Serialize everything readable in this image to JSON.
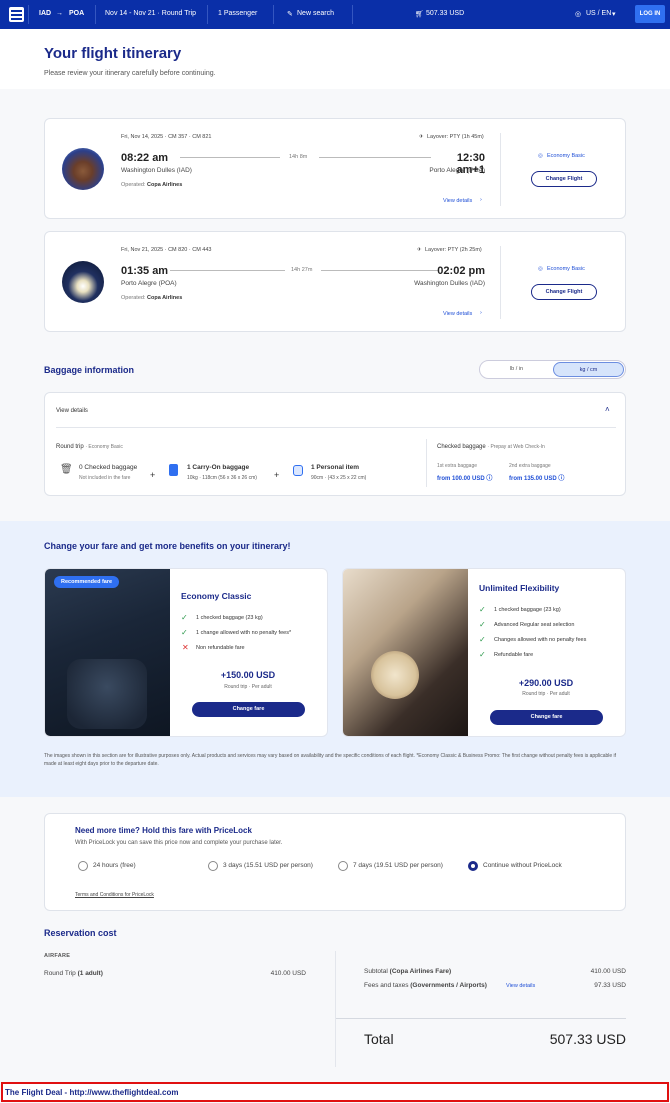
{
  "header": {
    "origin": "IAD",
    "destination": "POA",
    "arrow": "→",
    "dates": "Nov 14 - Nov 21 · Round Trip",
    "passengers": "1 Passenger",
    "new_search": "New search",
    "total": "507.33 USD",
    "locale": "US / EN",
    "login": "LOG IN"
  },
  "page": {
    "title": "Your flight itinerary",
    "subtitle": "Please review your itinerary carefully before continuing."
  },
  "flights": [
    {
      "date": "Fri, Nov 14, 2025 · CM 357 · CM 821",
      "layover": "Layover: PTY (1h 45m)",
      "dep_time": "08:22 am",
      "arr_time": "12:30 am+1",
      "duration": "14h 8m",
      "from": "Washington Dulles (IAD)",
      "to": "Porto Alegre (POA)",
      "operated_label": "Operated:",
      "operated_by": "Copa Airlines",
      "details": "View details",
      "fare": "Economy Basic",
      "change": "Change Flight"
    },
    {
      "date": "Fri, Nov 21, 2025 · CM 820 · CM 443",
      "layover": "Layover: PTY (2h 25m)",
      "dep_time": "01:35 am",
      "arr_time": "02:02 pm",
      "duration": "14h 27m",
      "from": "Porto Alegre (POA)",
      "to": "Washington Dulles (IAD)",
      "operated_label": "Operated:",
      "operated_by": "Copa Airlines",
      "details": "View details",
      "fare": "Economy Basic",
      "change": "Change Flight"
    }
  ],
  "baggage": {
    "title": "Baggage information",
    "unit_imperial": "lb / in",
    "unit_metric": "kg / cm",
    "view_details": "View details",
    "round_trip": "Round trip",
    "fare": "· Economy Basic",
    "checked_title": "0 Checked baggage",
    "checked_sub": "Not included in the fare",
    "carry_title": "1 Carry-On baggage",
    "carry_sub": "10kg · 118cm (56 x 36 x 26 cm)",
    "personal_title": "1 Personal item",
    "personal_sub": "90cm · (43 x 25 x 22 cm)",
    "checked_header": "Checked baggage",
    "prepay": "· Prepay at Web Check-In",
    "first_label": "1st extra baggage",
    "first_price": "from 100.00 USD",
    "second_label": "2nd extra baggage",
    "second_price": "from 135.00 USD",
    "plus": "+"
  },
  "upgrade": {
    "title": "Change your fare and get more benefits on your itinerary!",
    "classic": {
      "badge": "Recommended fare",
      "name": "Economy Classic",
      "b1": "1 checked baggage (23 kg)",
      "b2": "1 change allowed with no penalty fees*",
      "b3": "Non refundable fare",
      "price": "+150.00 USD",
      "per": "Round trip · Per adult",
      "button": "Change fare"
    },
    "flex": {
      "name": "Unlimited Flexibility",
      "b1": "1 checked baggage (23 kg)",
      "b2": "Advanced Regular seat selection",
      "b3": "Changes allowed with no penalty fees",
      "b4": "Refundable fare",
      "price": "+290.00 USD",
      "per": "Round trip · Per adult",
      "button": "Change fare"
    },
    "disclaimer": "The images shown in this section are for illustrative purposes only. Actual products and services may vary based on availability and the specific conditions of each flight. *Economy Classic & Business Promo: The first change without penalty fees is applicable if made at least eight days prior to the departure date."
  },
  "pricelock": {
    "title": "Need more time? Hold this fare with PriceLock",
    "subtitle": "With PriceLock you can save this price now and complete your purchase later.",
    "o1": "24 hours (free)",
    "o2": "3 days (15.51 USD per person)",
    "o3": "7 days (19.51 USD per person)",
    "o4": "Continue without PriceLock",
    "terms": "Terms and Conditions for PriceLock"
  },
  "cost": {
    "title": "Reservation cost",
    "airfare": "AIRFARE",
    "rt_label": "Round Trip",
    "rt_adult": "(1 adult)",
    "rt_amount": "410.00 USD",
    "subtotal_label": "Subtotal",
    "subtotal_desc": "(Copa Airlines Fare)",
    "subtotal": "410.00 USD",
    "fees_label": "Fees and taxes",
    "fees_desc": "(Governments / Airports)",
    "fees_link": "View details",
    "fees": "97.33 USD",
    "total_label": "Total",
    "total": "507.33 USD"
  },
  "footer": {
    "text": "The Flight Deal - http://www.theflightdeal.com"
  },
  "colors": {
    "brand": "#0a2fa8",
    "navy": "#1b2a8a",
    "link": "#1f4fd6",
    "footer_border": "#e01010"
  }
}
